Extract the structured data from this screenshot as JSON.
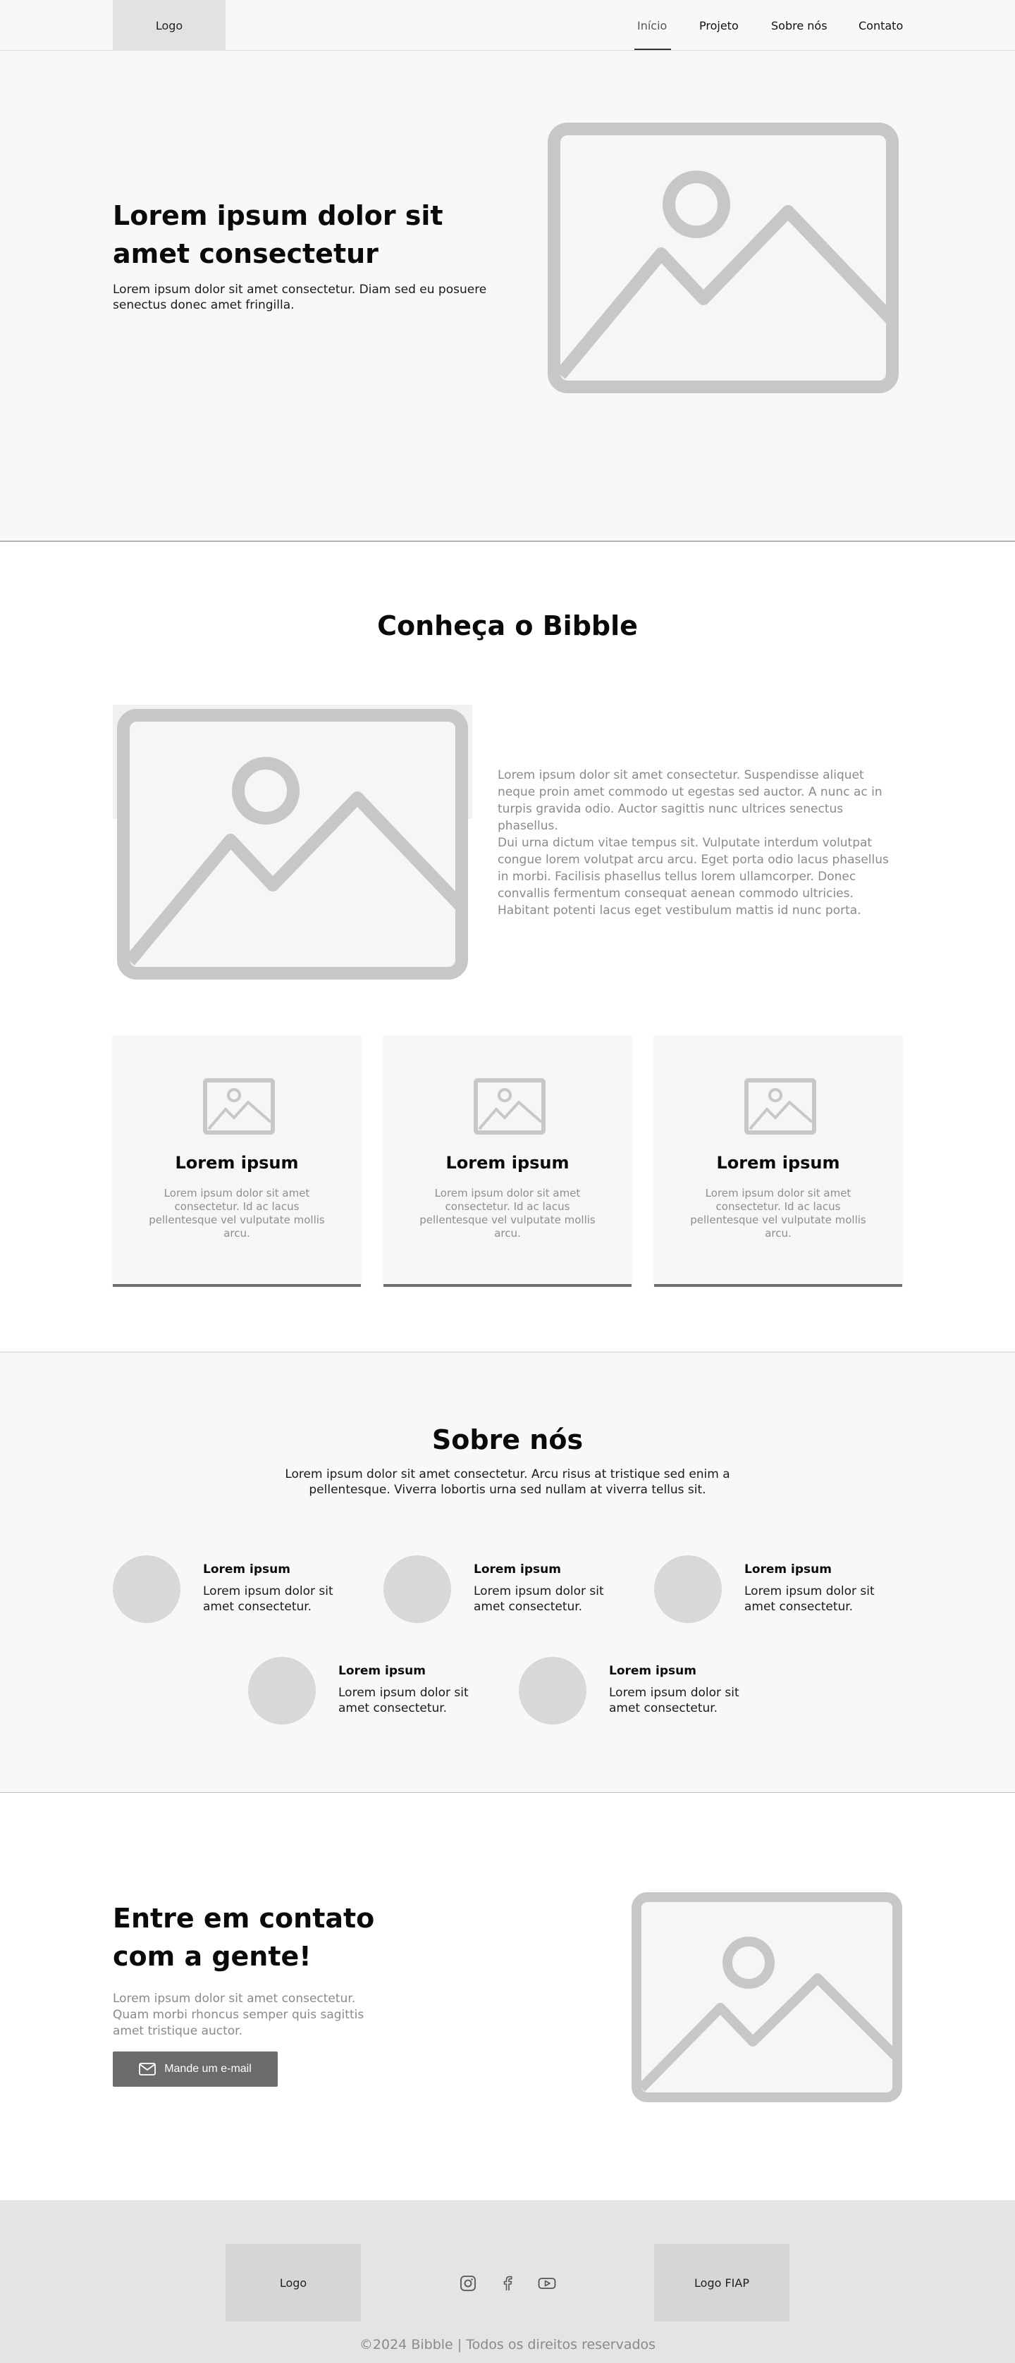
{
  "nav": {
    "logo": "Logo",
    "links": [
      {
        "label": "Início"
      },
      {
        "label": "Projeto"
      },
      {
        "label": "Sobre nós"
      },
      {
        "label": "Contato"
      }
    ]
  },
  "hero": {
    "title": "Lorem ipsum dolor sit amet consectetur",
    "text": "Lorem ipsum dolor sit amet consectetur. Diam sed eu posuere senectus donec amet fringilla.",
    "image_icon": "image-placeholder-icon"
  },
  "projeto": {
    "title": "Conheça o Bibble",
    "paragraph1": "Lorem ipsum dolor sit amet consectetur. Suspendisse aliquet neque proin amet commodo ut egestas sed auctor. A nunc ac in turpis gravida odio. Auctor sagittis nunc ultrices senectus phasellus.",
    "paragraph2": "Dui urna dictum vitae tempus sit. Vulputate interdum volutpat congue lorem volutpat arcu arcu. Eget porta odio lacus phasellus in morbi. Facilisis phasellus tellus lorem ullamcorper. Donec convallis fermentum consequat aenean commodo ultricies. Habitant potenti lacus eget vestibulum mattis id nunc porta.",
    "cards": [
      {
        "title": "Lorem ipsum",
        "text": "Lorem ipsum dolor sit amet consectetur. Id ac lacus pellentesque vel vulputate mollis arcu."
      },
      {
        "title": "Lorem ipsum",
        "text": "Lorem ipsum dolor sit amet consectetur. Id ac lacus pellentesque vel vulputate mollis arcu."
      },
      {
        "title": "Lorem ipsum",
        "text": "Lorem ipsum dolor sit amet consectetur. Id ac lacus pellentesque vel vulputate mollis arcu."
      }
    ]
  },
  "sobre": {
    "title": "Sobre nós",
    "text": "Lorem ipsum dolor sit amet consectetur. Arcu risus at tristique sed enim a pellentesque. Viverra lobortis urna sed nullam at viverra tellus sit.",
    "members": [
      {
        "name": "Lorem ipsum",
        "text": "Lorem ipsum dolor sit amet consectetur."
      },
      {
        "name": "Lorem ipsum",
        "text": "Lorem ipsum dolor sit amet consectetur."
      },
      {
        "name": "Lorem ipsum",
        "text": "Lorem ipsum dolor sit amet consectetur."
      },
      {
        "name": "Lorem ipsum",
        "text": "Lorem ipsum dolor sit amet consectetur."
      },
      {
        "name": "Lorem ipsum",
        "text": "Lorem ipsum dolor sit amet consectetur."
      }
    ]
  },
  "contato": {
    "title": "Entre em contato com a gente!",
    "text": "Lorem ipsum dolor sit amet consectetur. Quam morbi rhoncus semper quis sagittis amet tristique auctor.",
    "button_label": "Mande um e-mail",
    "button_icon": "mail-icon"
  },
  "footer": {
    "logo": "Logo",
    "logo_fiap": "Logo FIAP",
    "social_icons": [
      "instagram-icon",
      "facebook-icon",
      "youtube-icon"
    ],
    "copyright": "©2024 Bibble | Todos os direitos reservados"
  },
  "colors": {
    "placeholder_grey": "#c7c7c7",
    "section_bg": "#f8f8f8",
    "button_bg": "#6b6b6b",
    "footer_bg": "#e4e4e4"
  }
}
